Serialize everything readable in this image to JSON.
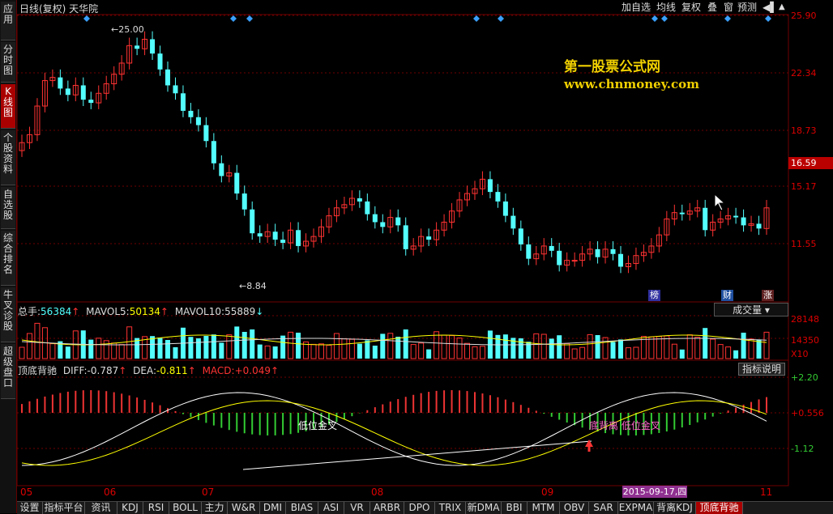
{
  "sidebar": {
    "items": [
      {
        "label": "应用",
        "active": false
      },
      {
        "label": "分时图",
        "active": false
      },
      {
        "label": "K线图",
        "active": true
      },
      {
        "label": "个股资料",
        "active": false
      },
      {
        "label": "自选股",
        "active": false
      },
      {
        "label": "综合排名",
        "active": false
      },
      {
        "label": "牛叉诊股",
        "active": false
      },
      {
        "label": "超级盘口",
        "active": false
      }
    ]
  },
  "header": {
    "title": "日线(复权) 天华院",
    "buttons": [
      "加自选",
      "均线",
      "复权",
      "叠",
      "窗",
      "预测"
    ],
    "window_icon": "◀▌",
    "close_icon": "▲"
  },
  "price_axis": [
    "25.90",
    "22.34",
    "18.73",
    "15.17",
    "11.55"
  ],
  "current_price": "16.59",
  "annotations": {
    "high": "25.00",
    "low": "8.84"
  },
  "watermark": {
    "line1": "第一股票公式网",
    "line2": "www.chnmoney.com"
  },
  "badges": {
    "b1": "榜",
    "b2": "财",
    "b3": "涨"
  },
  "volume": {
    "label_total": "总手:",
    "total": "56384",
    "label_ma5": "MAVOL5:",
    "ma5": "50134",
    "label_ma10": "MAVOL10:",
    "ma10": "55889",
    "axis": [
      "28148",
      "14350",
      "X10"
    ],
    "dropdown": "成交量"
  },
  "macd": {
    "name": "顶底背驰",
    "label_diff": "DIFF:",
    "diff": "-0.787",
    "label_dea": "DEA:",
    "dea": "-0.811",
    "label_macd": "MACD:",
    "macd": "+0.049",
    "axis": [
      "+2.20",
      "+0.556",
      "-1.12"
    ],
    "button": "指标说明",
    "signal1": "低位金叉",
    "signal2": "底背离  低位金叉"
  },
  "dates": {
    "d1": "05",
    "d2": "06",
    "d3": "07",
    "d4": "08",
    "d5": "09",
    "highlight": "2015-09-17,四",
    "d6": "11"
  },
  "tabs": [
    "设置",
    "指标平台",
    "资讯",
    "KDJ",
    "RSI",
    "BOLL",
    "主力",
    "W&R",
    "DMI",
    "BIAS",
    "ASI",
    "VR",
    "ARBR",
    "DPO",
    "TRIX",
    "新DMA",
    "BBI",
    "MTM",
    "OBV",
    "SAR",
    "EXPMA",
    "背离KDJ",
    "顶底背驰"
  ],
  "colors": {
    "up": "#ff3232",
    "down": "#54ffff",
    "bg": "#000000",
    "grid": "#700000",
    "accent": "#f0d000"
  }
}
